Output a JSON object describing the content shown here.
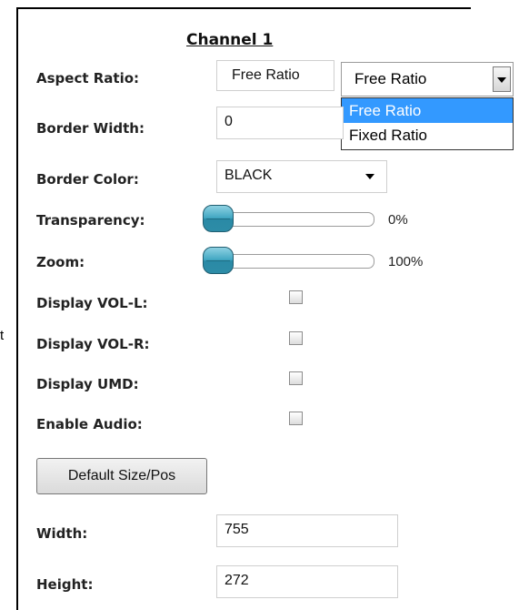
{
  "panel": {
    "title": "Channel 1",
    "stray_text": "t"
  },
  "aspect_ratio": {
    "label": "Aspect Ratio:",
    "value": "Free Ratio",
    "select_value": "Free Ratio",
    "options": [
      "Free Ratio",
      "Fixed Ratio"
    ]
  },
  "border_width": {
    "label": "Border Width:",
    "value": "0"
  },
  "border_color": {
    "label": "Border Color:",
    "value": "BLACK"
  },
  "transparency": {
    "label": "Transparency:",
    "value": "0%",
    "level": 0
  },
  "zoom": {
    "label": "Zoom:",
    "value": "100%",
    "level": 0
  },
  "display_vol_l": {
    "label": "Display VOL-L:"
  },
  "display_vol_r": {
    "label": "Display VOL-R:"
  },
  "display_umd": {
    "label": "Display UMD:"
  },
  "enable_audio": {
    "label": "Enable Audio:"
  },
  "default_button": {
    "label": "Default Size/Pos"
  },
  "width": {
    "label": "Width:",
    "value": "755"
  },
  "height": {
    "label": "Height:",
    "value": "272"
  },
  "icons": {
    "select_arrow": "chevron-down-icon",
    "slider_knob": "slider-knob-icon"
  },
  "colors": {
    "selected_option": "#3399ff",
    "knob": "#41a7c2"
  }
}
